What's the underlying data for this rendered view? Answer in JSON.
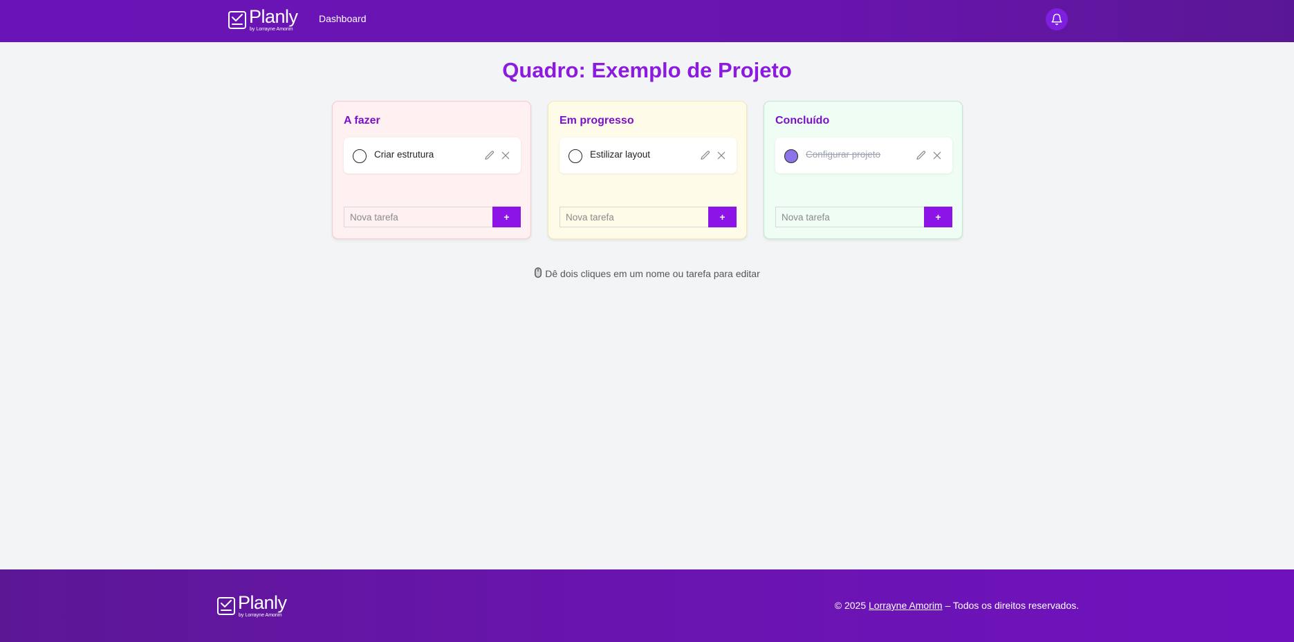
{
  "header": {
    "logo": {
      "word": "Planly",
      "by": "by Lorrayne Amorim"
    },
    "nav": {
      "dashboard": "Dashboard"
    },
    "icons": {
      "notifications": "bell-icon"
    }
  },
  "main": {
    "title": "Quadro: Exemplo de Projeto",
    "columns": [
      {
        "title": "A fazer",
        "tasks": [
          {
            "label": "Criar estrutura",
            "done": false
          }
        ],
        "input_placeholder": "Nova tarefa",
        "add_label": "+"
      },
      {
        "title": "Em progresso",
        "tasks": [
          {
            "label": "Estilizar layout",
            "done": false
          }
        ],
        "input_placeholder": "Nova tarefa",
        "add_label": "+"
      },
      {
        "title": "Concluído",
        "tasks": [
          {
            "label": "Configurar projeto",
            "done": true
          }
        ],
        "input_placeholder": "Nova tarefa",
        "add_label": "+"
      }
    ],
    "hint": "Dê dois cliques em um nome ou tarefa para editar"
  },
  "footer": {
    "logo": {
      "word": "Planly",
      "by": "by Lorrayne Amorim"
    },
    "copyright_prefix": "© 2025 ",
    "author": "Lorrayne Amorim",
    "copyright_suffix": " – Todos os direitos reservados."
  },
  "colors": {
    "brand": "#6a14b0",
    "accent": "#8d14e6",
    "title": "#8c1bdf",
    "todo_bg": "#fff1f2",
    "progress_bg": "#fffbe9",
    "done_bg": "#effdf4",
    "done_check": "#8b74e8"
  }
}
